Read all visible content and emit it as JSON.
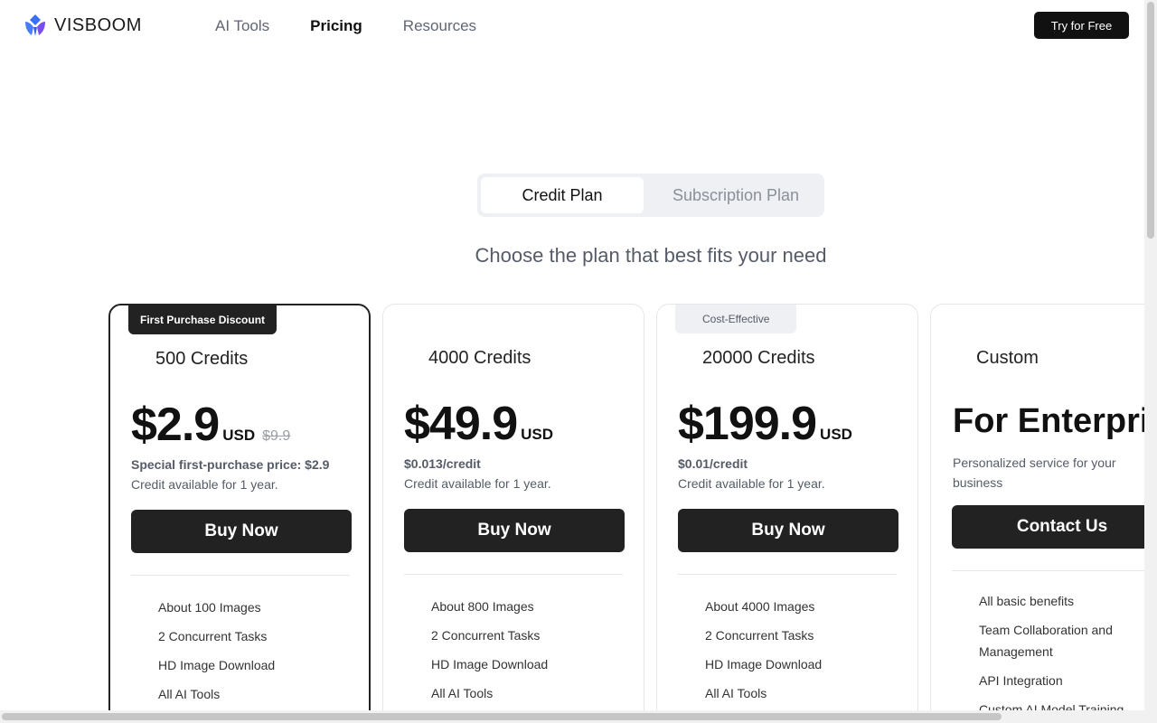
{
  "header": {
    "brand": "VISBOOM",
    "nav": [
      "AI Tools",
      "Pricing",
      "Resources"
    ],
    "cta": "Try for Free"
  },
  "toggle": {
    "selected": "Credit Plan",
    "other": "Subscription Plan"
  },
  "headline": "Choose the plan that best fits your need",
  "plans": [
    {
      "badge": "First Purchase Discount",
      "name": "500 Credits",
      "price": "$2.9",
      "currency": "USD",
      "old_price": "$9.9",
      "note": "Special first-purchase price: $2.9",
      "availability": "Credit available for 1 year.",
      "button": "Buy Now",
      "features": [
        "About 100 Images",
        "2 Concurrent Tasks",
        "HD Image Download",
        "All AI Tools"
      ]
    },
    {
      "name": "4000 Credits",
      "price": "$49.9",
      "currency": "USD",
      "note": "$0.013/credit",
      "availability": "Credit available for 1 year.",
      "button": "Buy Now",
      "features": [
        "About 800 Images",
        "2 Concurrent Tasks",
        "HD Image Download",
        "All AI Tools"
      ]
    },
    {
      "badge": "Cost-Effective",
      "name": "20000 Credits",
      "price": "$199.9",
      "currency": "USD",
      "note": "$0.01/credit",
      "availability": "Credit available for 1 year.",
      "button": "Buy Now",
      "features": [
        "About 4000 Images",
        "2 Concurrent Tasks",
        "HD Image Download",
        "All AI Tools"
      ]
    },
    {
      "name": "Custom",
      "title": "For Enterprise",
      "description": "Personalized service for your business",
      "button": "Contact Us",
      "features": [
        "All basic benefits",
        "Team Collaboration and Management",
        "API Integration",
        "Custom AI Model Training"
      ]
    }
  ]
}
